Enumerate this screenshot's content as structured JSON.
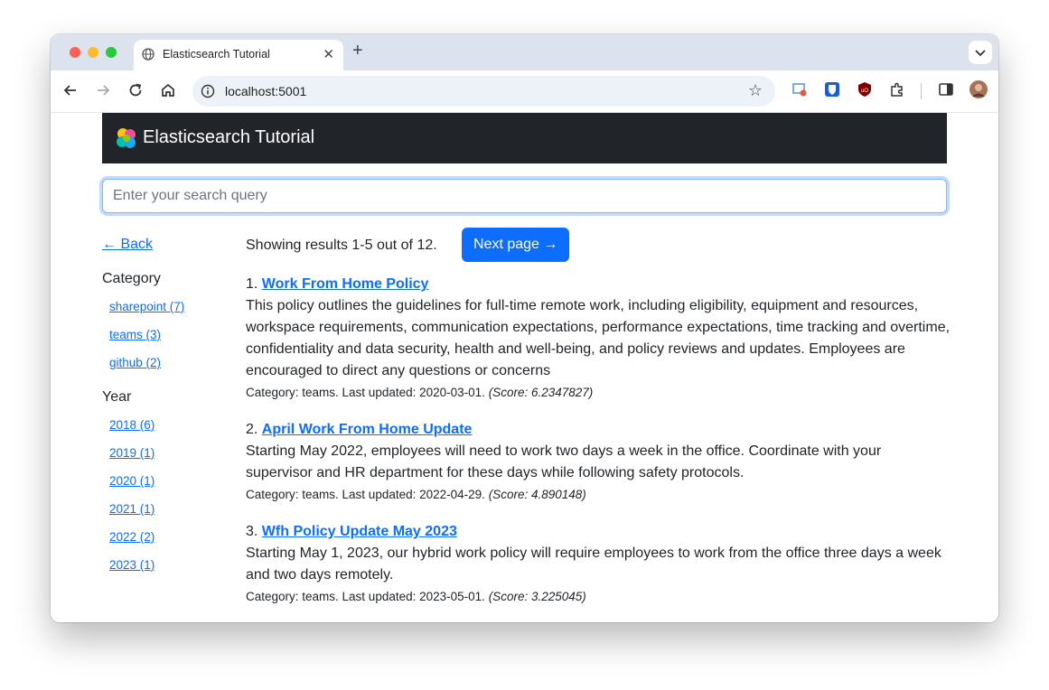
{
  "browser": {
    "tab_title": "Elasticsearch Tutorial",
    "tab_close": "✕",
    "new_tab": "+",
    "url": "localhost:5001",
    "icons": [
      "back-icon",
      "forward-icon",
      "reload-icon",
      "home-icon",
      "info-icon",
      "star-icon",
      "extension-icons",
      "sidepanel-icon",
      "profile-avatar"
    ]
  },
  "app": {
    "brand": "Elasticsearch Tutorial",
    "search_placeholder": "Enter your search query",
    "back_label": "← Back",
    "category_heading": "Category",
    "categories": [
      "sharepoint (7)",
      "teams (3)",
      "github (2)"
    ],
    "year_heading": "Year",
    "years": [
      "2018 (6)",
      "2019 (1)",
      "2020 (1)",
      "2021 (1)",
      "2022 (2)",
      "2023 (1)"
    ],
    "showing_text": "Showing results 1-5 out of 12.",
    "next_label": "Next page →",
    "results": [
      {
        "index": "1.",
        "title": "Work From Home Policy",
        "description": "This policy outlines the guidelines for full-time remote work, including eligibility, equipment and resources, workspace requirements, communication expectations, performance expectations, time tracking and overtime, confidentiality and data security, health and well-being, and policy reviews and updates. Employees are encouraged to direct any questions or concerns",
        "meta": "Category: teams. Last updated: 2020-03-01.",
        "score": "(Score: 6.2347827)"
      },
      {
        "index": "2.",
        "title": "April Work From Home Update",
        "description": "Starting May 2022, employees will need to work two days a week in the office. Coordinate with your supervisor and HR department for these days while following safety protocols.",
        "meta": "Category: teams. Last updated: 2022-04-29.",
        "score": "(Score: 4.890148)"
      },
      {
        "index": "3.",
        "title": "Wfh Policy Update May 2023",
        "description": "Starting May 1, 2023, our hybrid work policy will require employees to work from the office three days a week and two days remotely.",
        "meta": "Category: teams. Last updated: 2023-05-01.",
        "score": "(Score: 3.225045)"
      }
    ]
  },
  "colors": {
    "accent": "#0d6efd",
    "navbar": "#212529"
  }
}
